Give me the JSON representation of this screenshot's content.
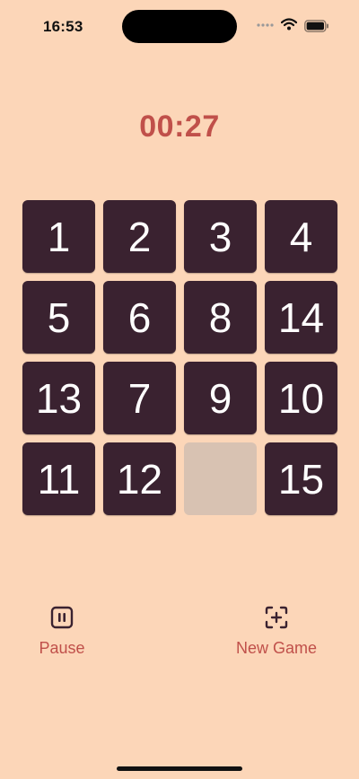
{
  "status_bar": {
    "time": "16:53"
  },
  "timer": "00:27",
  "board": {
    "tiles": [
      "1",
      "2",
      "3",
      "4",
      "5",
      "6",
      "8",
      "14",
      "13",
      "7",
      "9",
      "10",
      "11",
      "12",
      "",
      "15"
    ]
  },
  "toolbar": {
    "pause_label": "Pause",
    "new_game_label": "New Game",
    "pause_icon": "pause-icon",
    "new_game_icon": "scan-plus-icon"
  },
  "colors": {
    "background": "#fcd6b8",
    "tile": "#3a2230",
    "accent": "#c0504a",
    "empty_slot": "#d8c2b2"
  }
}
